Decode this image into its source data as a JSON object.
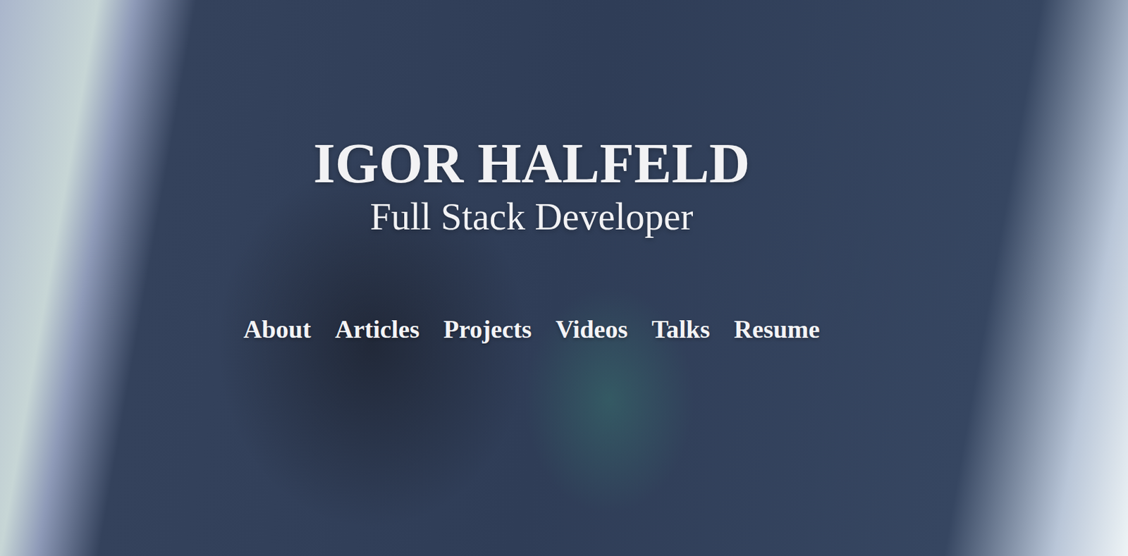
{
  "header": {
    "name": "IGOR HALFELD",
    "title": "Full Stack Developer"
  },
  "nav": [
    {
      "label": "About"
    },
    {
      "label": "Articles"
    },
    {
      "label": "Projects"
    },
    {
      "label": "Videos"
    },
    {
      "label": "Talks"
    },
    {
      "label": "Resume"
    }
  ]
}
